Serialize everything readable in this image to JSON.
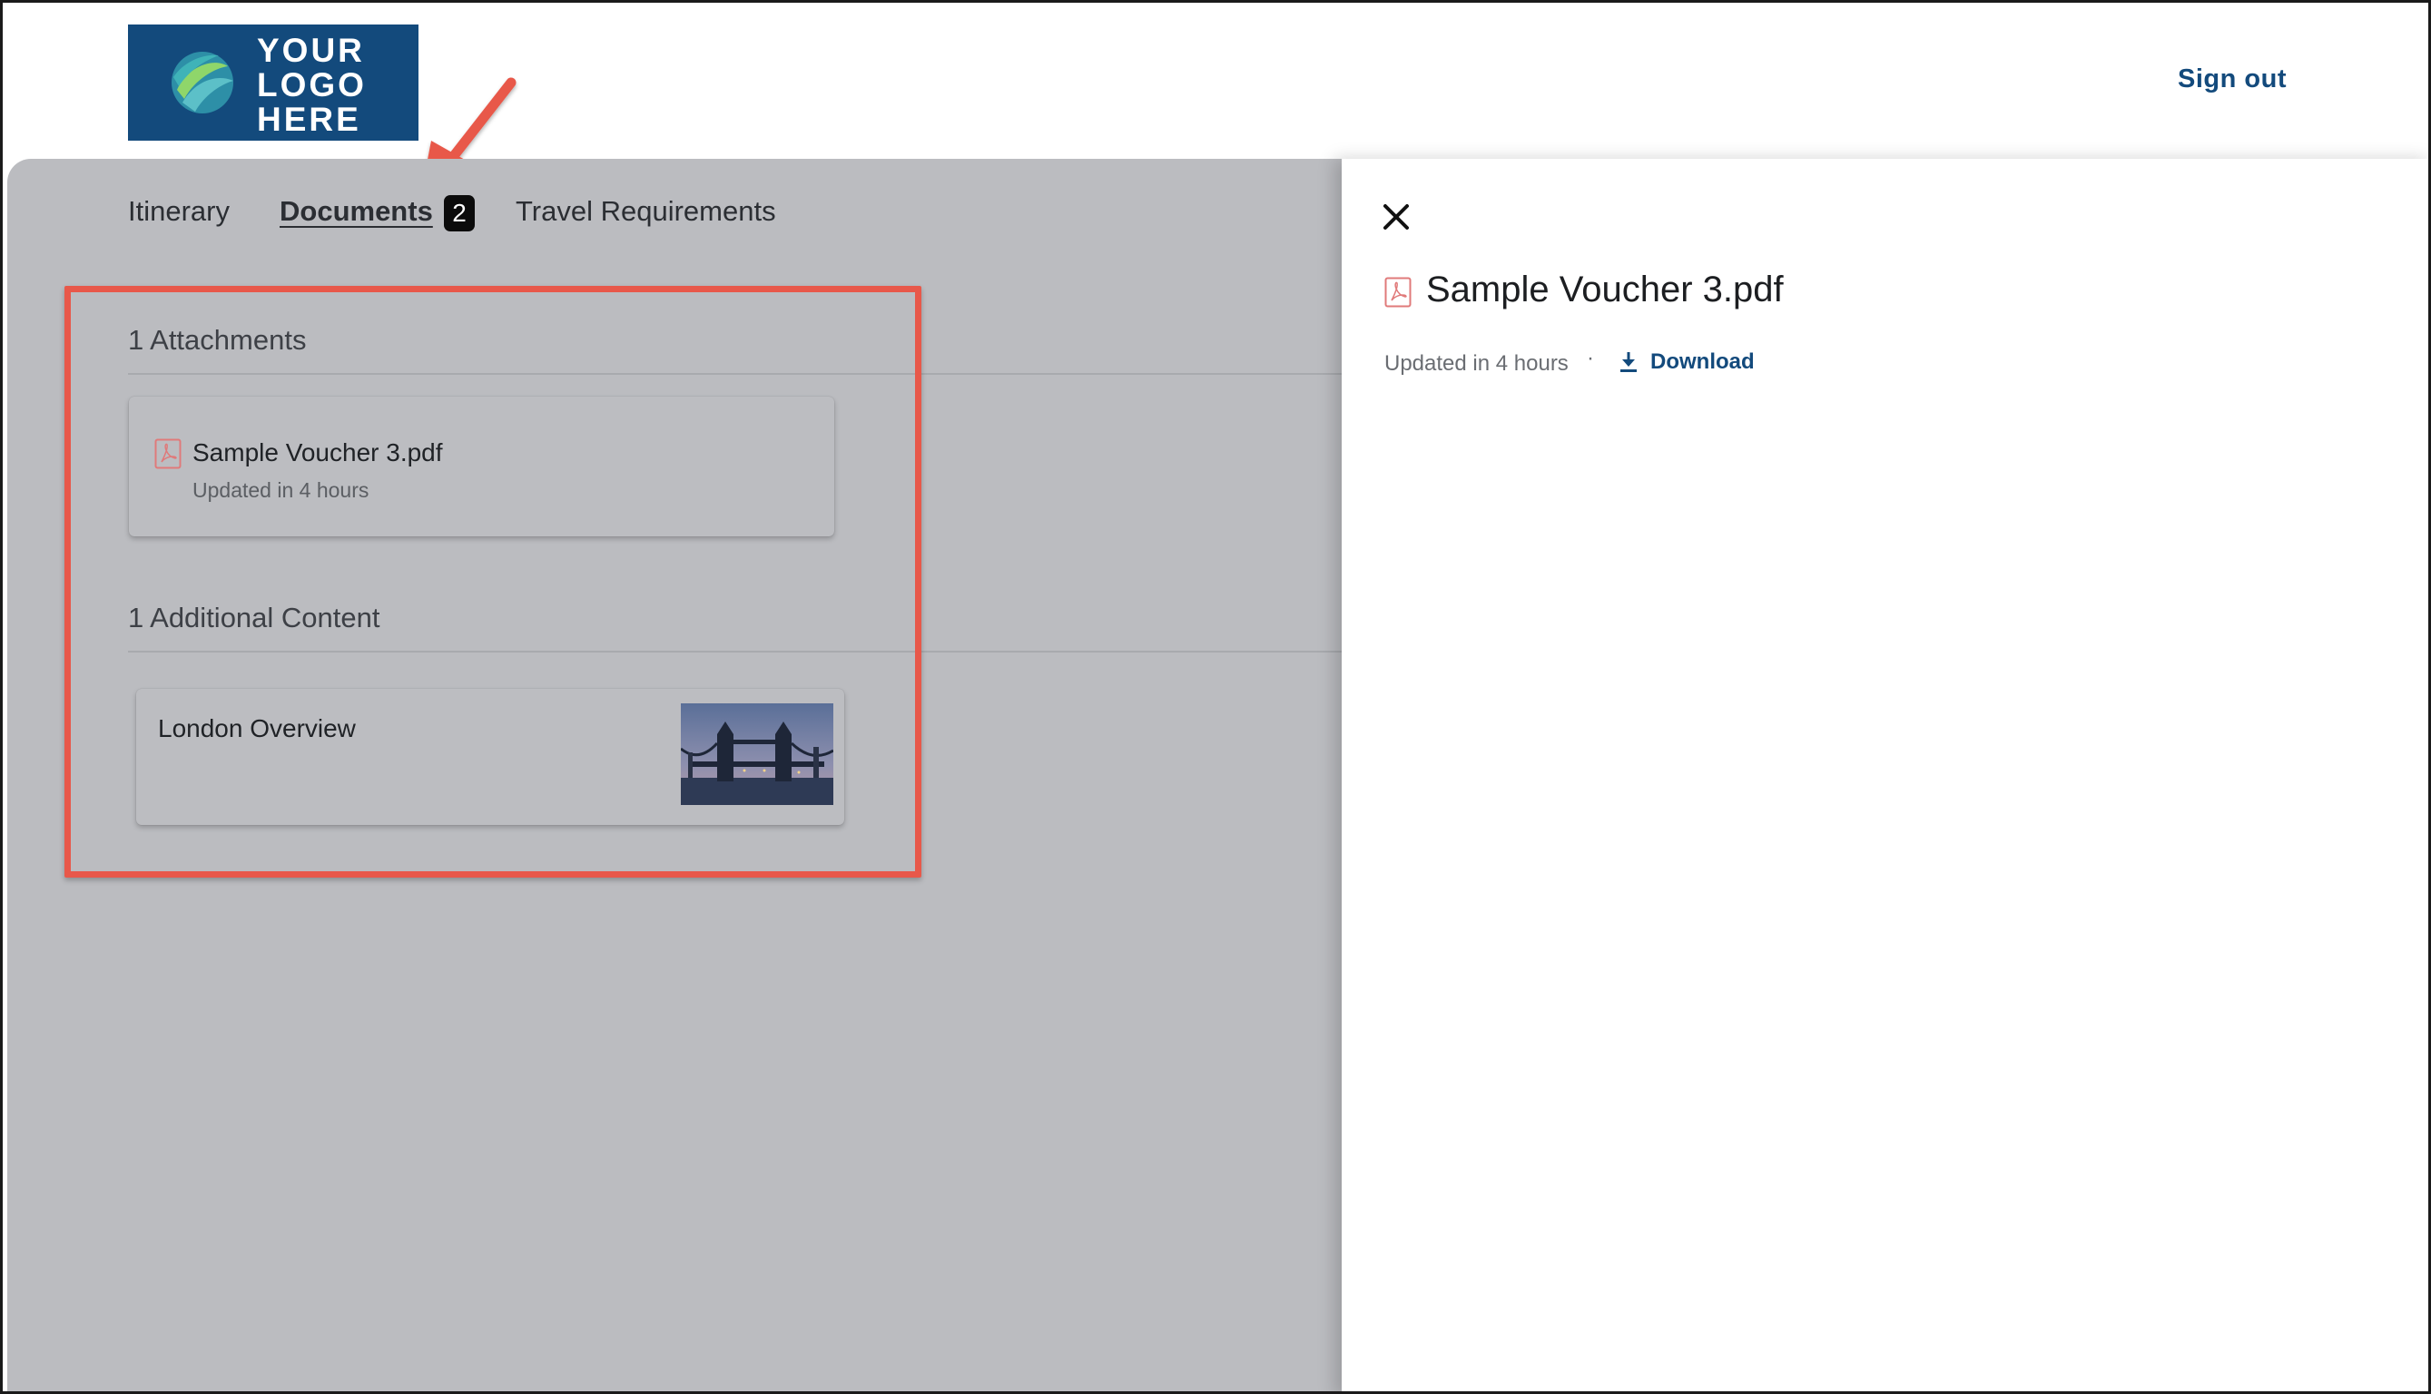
{
  "header": {
    "logo_text": "YOUR LOGO HERE",
    "sign_out_label": "Sign out"
  },
  "tabs": [
    {
      "label": "Itinerary",
      "active": false
    },
    {
      "label": "Documents",
      "active": true,
      "badge": "2"
    },
    {
      "label": "Travel Requirements",
      "active": false
    }
  ],
  "attachments": {
    "title": "1 Attachments",
    "items": [
      {
        "name": "Sample Voucher 3.pdf",
        "meta": "Updated in 4 hours",
        "icon": "pdf-icon"
      }
    ]
  },
  "additional_content": {
    "title": "1 Additional Content",
    "items": [
      {
        "title": "London Overview",
        "thumbnail": "tower-bridge-photo"
      }
    ]
  },
  "drawer": {
    "title": "Sample Voucher 3.pdf",
    "meta": "Updated in 4 hours",
    "separator": "·",
    "download_label": "Download"
  },
  "colors": {
    "brand": "#134a7c",
    "overlay_gray": "#bbbcc0",
    "annotation_red": "#e8584a",
    "badge_black": "#0b0b0b",
    "pdf_red": "#e07a7a"
  }
}
